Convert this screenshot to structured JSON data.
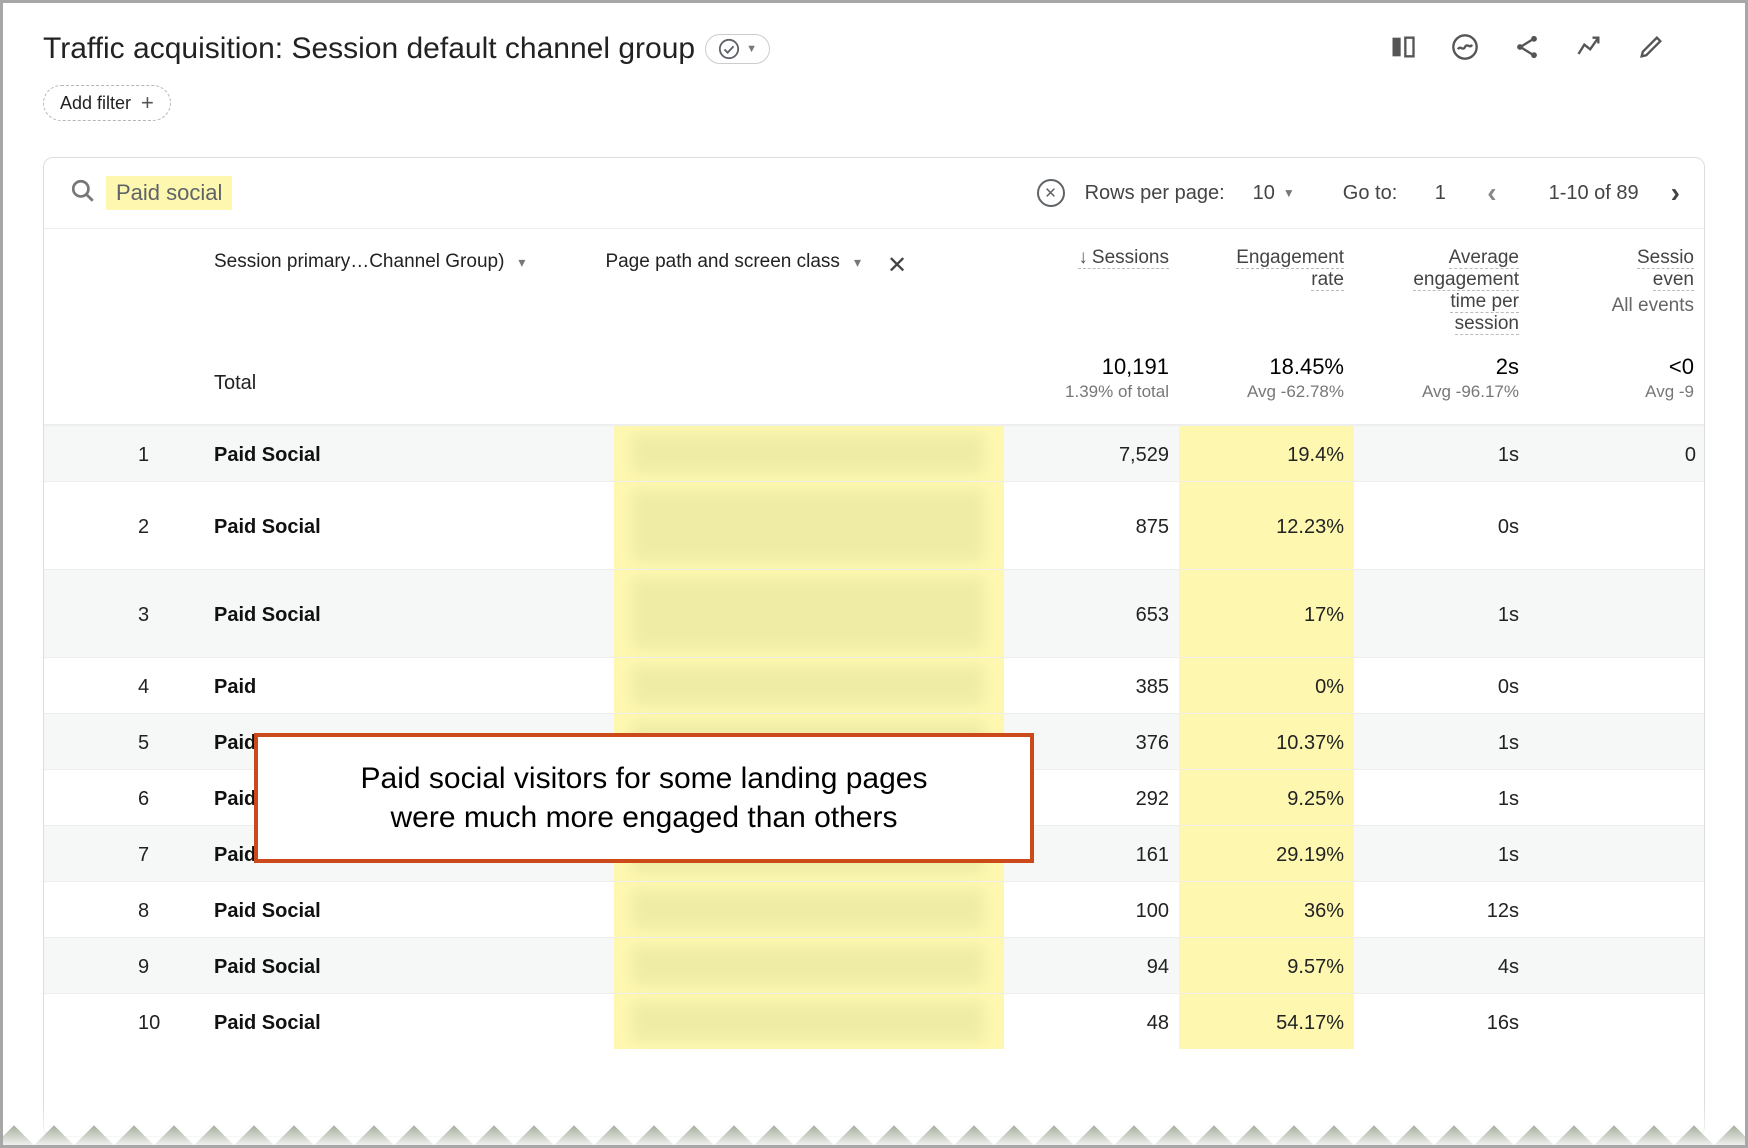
{
  "header": {
    "title": "Traffic acquisition: Session default channel group",
    "add_filter": "Add filter"
  },
  "search": {
    "query": "Paid social"
  },
  "pager": {
    "rows_label": "Rows per page:",
    "rows_value": "10",
    "goto_label": "Go to:",
    "goto_value": "1",
    "range": "1-10 of 89"
  },
  "dimensions": {
    "primary": "Session primary…Channel Group)",
    "secondary": "Page path and screen class"
  },
  "metrics": {
    "sessions": "Sessions",
    "engagement_head": "Engagement",
    "engagement_sub": "rate",
    "avgtime_head": "Average",
    "avgtime_sub1": "engagement",
    "avgtime_sub2": "time per",
    "avgtime_sub3": "session",
    "events_head": "Sessio",
    "events_sub1": "even",
    "events_sub2": "All events"
  },
  "totals": {
    "label": "Total",
    "sessions": "10,191",
    "sessions_sub": "1.39% of total",
    "erate": "18.45%",
    "erate_sub": "Avg -62.78%",
    "avgtime": "2s",
    "avgtime_sub": "Avg -96.17%",
    "events": "<0",
    "events_sub": "Avg -9"
  },
  "rows": [
    {
      "idx": "1",
      "channel": "Paid Social",
      "sessions": "7,529",
      "erate": "19.4%",
      "time": "1s",
      "ev": "0"
    },
    {
      "idx": "2",
      "channel": "Paid Social",
      "sessions": "875",
      "erate": "12.23%",
      "time": "0s",
      "ev": ""
    },
    {
      "idx": "3",
      "channel": "Paid Social",
      "sessions": "653",
      "erate": "17%",
      "time": "1s",
      "ev": ""
    },
    {
      "idx": "4",
      "channel": "Paid",
      "sessions": "385",
      "erate": "0%",
      "time": "0s",
      "ev": ""
    },
    {
      "idx": "5",
      "channel": "Paid",
      "sessions": "376",
      "erate": "10.37%",
      "time": "1s",
      "ev": ""
    },
    {
      "idx": "6",
      "channel": "Paid",
      "sessions": "292",
      "erate": "9.25%",
      "time": "1s",
      "ev": ""
    },
    {
      "idx": "7",
      "channel": "Paid Social",
      "sessions": "161",
      "erate": "29.19%",
      "time": "1s",
      "ev": ""
    },
    {
      "idx": "8",
      "channel": "Paid Social",
      "sessions": "100",
      "erate": "36%",
      "time": "12s",
      "ev": ""
    },
    {
      "idx": "9",
      "channel": "Paid Social",
      "sessions": "94",
      "erate": "9.57%",
      "time": "4s",
      "ev": ""
    },
    {
      "idx": "10",
      "channel": "Paid Social",
      "sessions": "48",
      "erate": "54.17%",
      "time": "16s",
      "ev": ""
    }
  ],
  "callout": {
    "line1": "Paid social visitors for some landing pages",
    "line2": "were much more engaged than others"
  },
  "colors": {
    "highlight": "#fdf7b0",
    "callout_border": "#cc4a1a"
  }
}
